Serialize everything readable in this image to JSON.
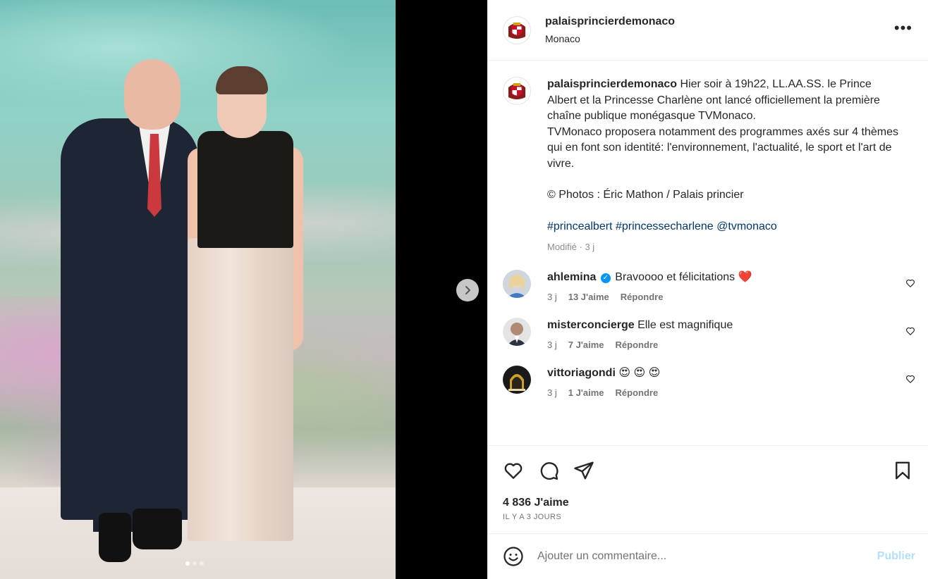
{
  "post": {
    "username": "palaisprincierdemonaco",
    "location": "Monaco",
    "more_glyph": "•••"
  },
  "carousel": {
    "count": 3,
    "active_index": 0
  },
  "caption": {
    "username": "palaisprincierdemonaco",
    "text1": "Hier soir à 19h22, LL.AA.SS. le Prince Albert et la Princesse Charlène ont lancé officiellement la première chaîne publique monégasque TVMonaco.",
    "text2": "TVMonaco proposera notamment des programmes axés sur 4 thèmes qui en font son identité: l'environnement, l'actualité, le sport et l'art de vivre.",
    "credit": "© Photos : Éric Mathon / Palais princier",
    "tag1": "#princealbert",
    "tag2": "#princessecharlene",
    "tag3": "@tvmonaco",
    "edited": "Modifié · 3 j"
  },
  "comments": [
    {
      "username": "ahlemina",
      "verified": true,
      "text": "Bravoooo et félicitations",
      "emoji": "❤️",
      "time": "3 j",
      "likes": "13 J'aime",
      "reply": "Répondre"
    },
    {
      "username": "misterconcierge",
      "verified": false,
      "text": "Elle est magnifique",
      "emoji": "",
      "time": "3 j",
      "likes": "7 J'aime",
      "reply": "Répondre"
    },
    {
      "username": "vittoriagondi",
      "verified": false,
      "text": "",
      "emoji": "😍 😍 😍",
      "time": "3 j",
      "likes": "1 J'aime",
      "reply": "Répondre"
    }
  ],
  "stats": {
    "likes": "4 836 J'aime",
    "time_ago": "IL Y A 3 JOURS"
  },
  "composer": {
    "placeholder": "Ajouter un commentaire...",
    "post_label": "Publier"
  },
  "colors": {
    "link": "#00376b",
    "verified": "#0095f6",
    "publish_disabled": "#b2dffc",
    "muted": "#737373"
  }
}
